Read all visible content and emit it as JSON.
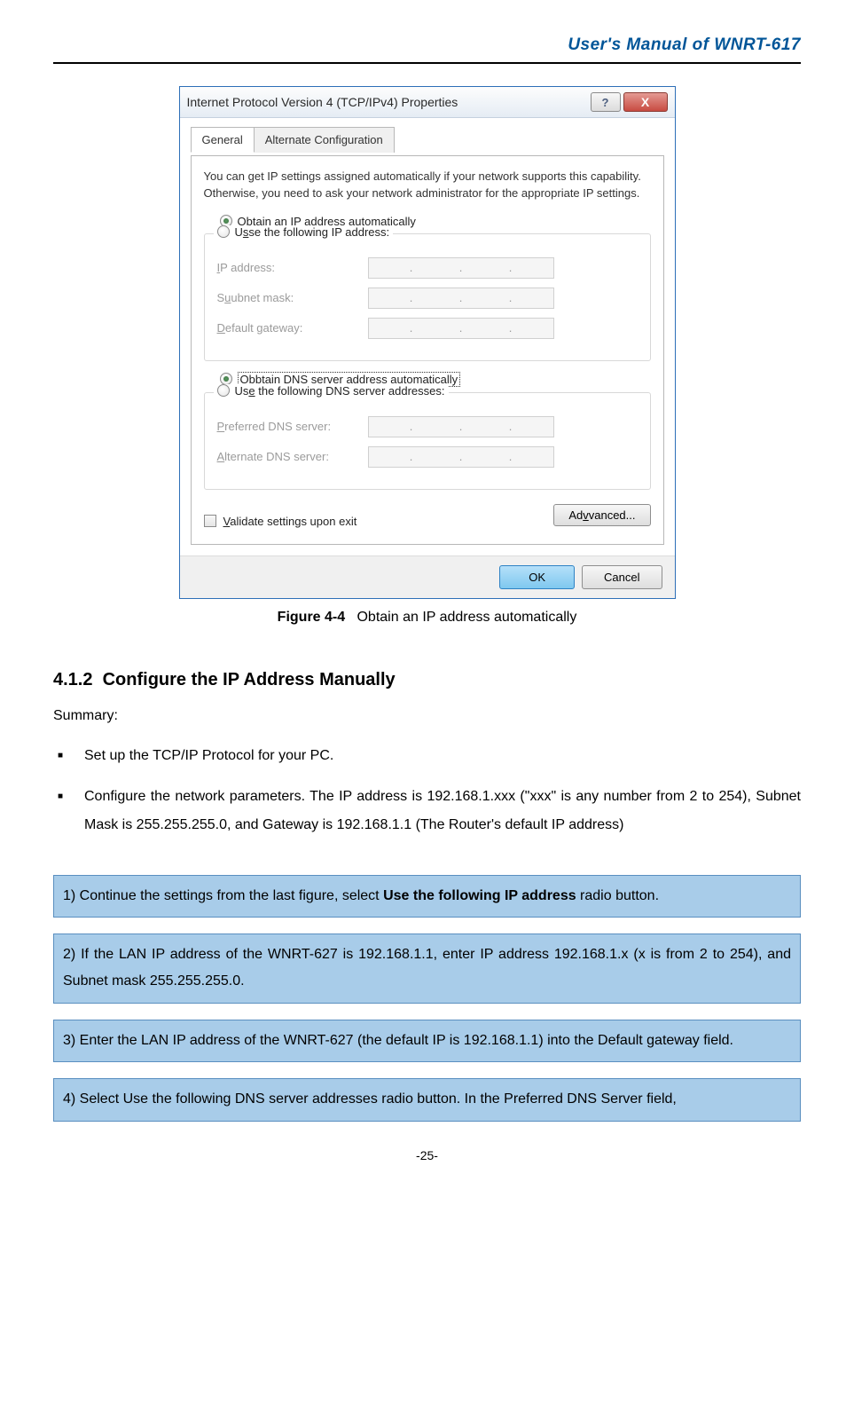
{
  "header": {
    "title": "User's Manual of WNRT-617"
  },
  "dialog": {
    "title": "Internet Protocol Version 4 (TCP/IPv4) Properties",
    "help": "?",
    "close": "X",
    "tabs": {
      "general": "General",
      "alternate": "Alternate Configuration"
    },
    "intro": "You can get IP settings assigned automatically if your network supports this capability. Otherwise, you need to ask your network administrator for the appropriate IP settings.",
    "radio_obtain_ip_pre": "O",
    "radio_obtain_ip_post": "btain an IP address automatically",
    "radio_use_ip_pre": "U",
    "radio_use_ip_post": "se the following IP address:",
    "ip_address_pre": "I",
    "ip_address_post": "P address:",
    "subnet_pre": "S",
    "subnet_post": "ubnet mask:",
    "gateway_pre": "D",
    "gateway_post": "efault gateway:",
    "radio_obtain_dns_pre": "O",
    "radio_obtain_dns_post": "btain DNS server address automatically",
    "radio_use_dns_pre": "Us",
    "radio_use_dns_post": "e the following DNS server addresses:",
    "pref_dns_pre": "P",
    "pref_dns_post": "referred DNS server:",
    "alt_dns_pre": "Alternate DNS ser",
    "alt_dns_post": "ver:",
    "validate_pre": "V",
    "validate_post": "alidate settings upon exit",
    "advanced_pre": "Ad",
    "advanced_post": "vanced...",
    "ok": "OK",
    "cancel": "Cancel"
  },
  "figure": {
    "label": "Figure 4-4",
    "caption": "Obtain an IP address automatically"
  },
  "section": {
    "number": "4.1.2",
    "title": "Configure the IP Address Manually"
  },
  "summary": {
    "label": "Summary:",
    "bullets": [
      "Set up the TCP/IP Protocol for your PC.",
      "Configure the network parameters. The IP address is 192.168.1.xxx (\"xxx\" is any number from 2 to 254), Subnet Mask is 255.255.255.0, and Gateway is 192.168.1.1 (The Router's default IP address)"
    ]
  },
  "steps": {
    "s1_pre": "1)  Continue the settings from the last figure, select ",
    "s1_bold": "Use the following IP address",
    "s1_post": " radio button.",
    "s2": "2)  If the LAN IP address of the WNRT-627 is 192.168.1.1, enter IP address 192.168.1.x (x is from 2 to 254), and Subnet mask 255.255.255.0.",
    "s3": "3)  Enter the LAN IP address of the WNRT-627 (the default IP is 192.168.1.1) into the Default gateway field.",
    "s4": "4)  Select Use the following DNS server addresses radio button. In the Preferred DNS Server field,"
  },
  "pagenum": "-25-"
}
